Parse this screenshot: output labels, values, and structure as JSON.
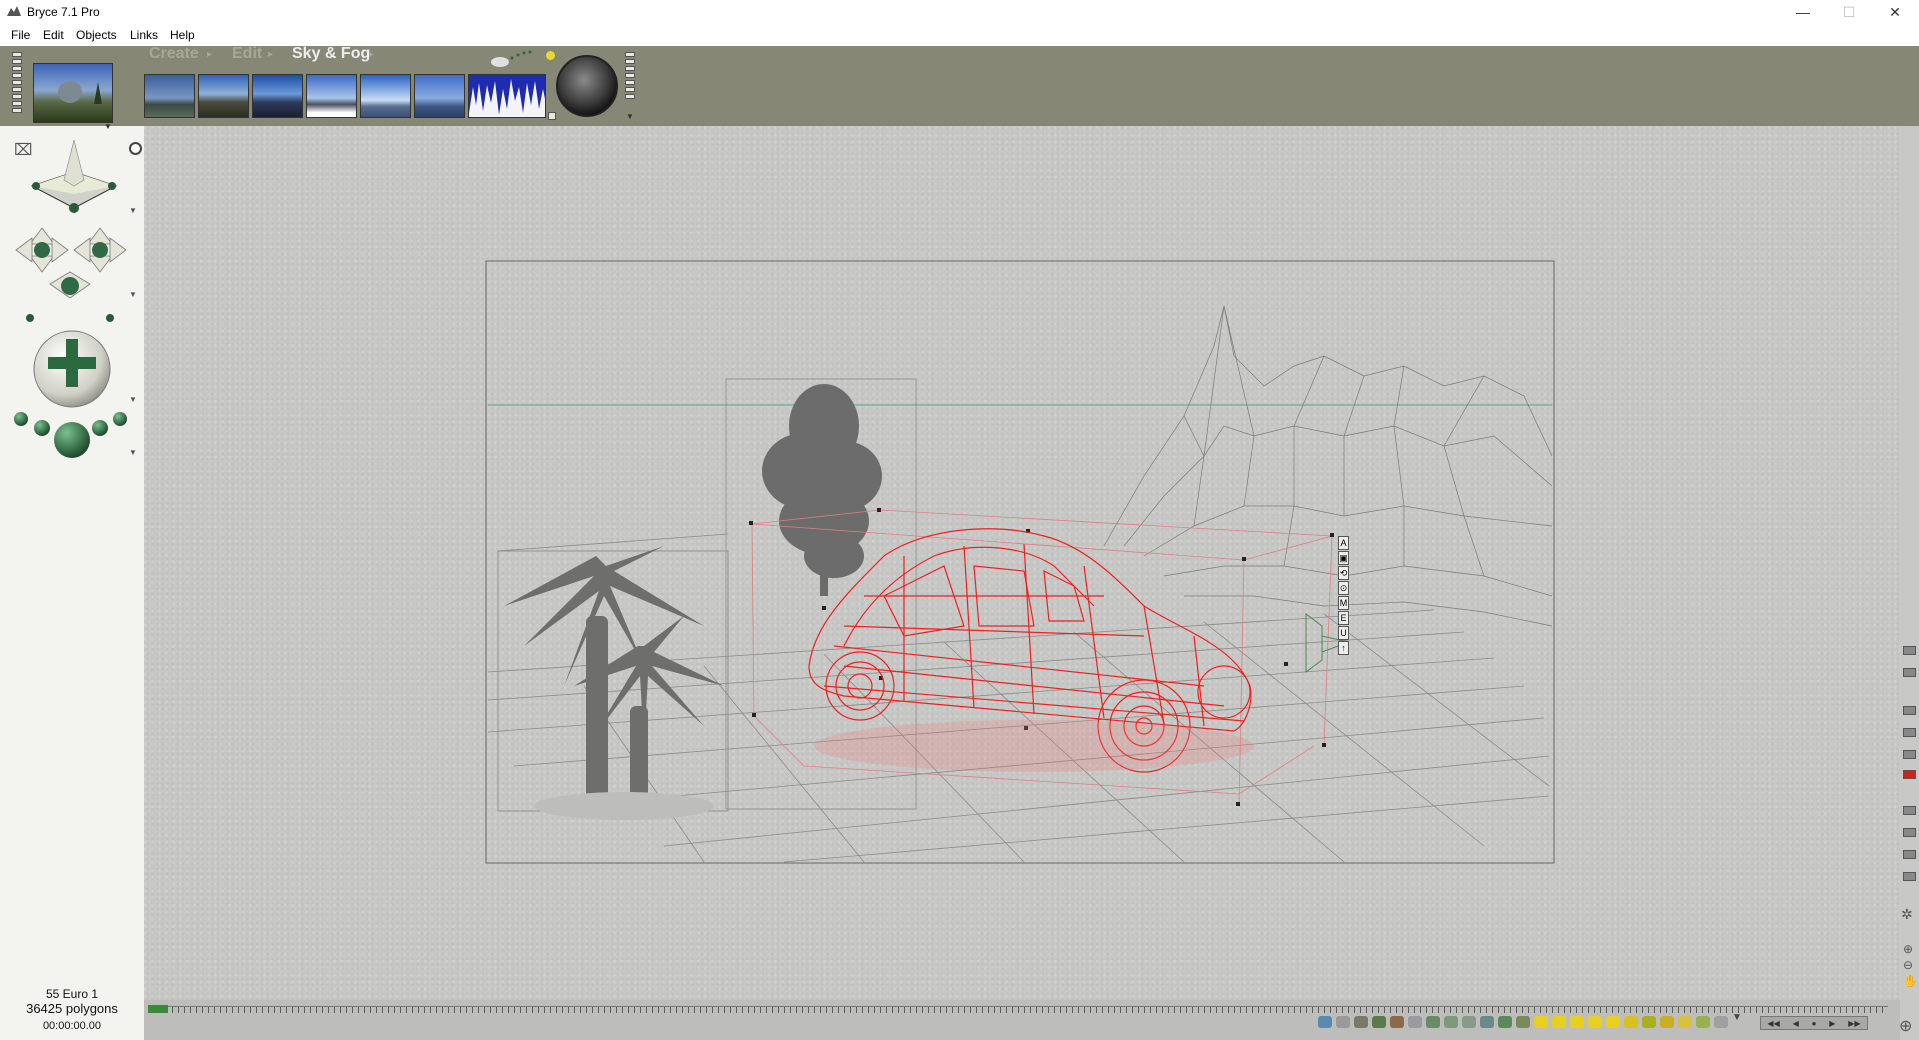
{
  "window": {
    "title": "Bryce 7.1  Pro",
    "controls": {
      "minimize": "—",
      "maximize": "☐",
      "close": "✕"
    }
  },
  "menubar": {
    "items": [
      {
        "label": "File"
      },
      {
        "label": "Edit"
      },
      {
        "label": "Objects"
      },
      {
        "label": "Links"
      },
      {
        "label": "Help"
      }
    ]
  },
  "palette_tabs": {
    "create": "Create",
    "edit": "Edit",
    "sky_fog": "Sky & Fog"
  },
  "status": {
    "scene_name": "55 Euro 1",
    "polygons": "36425 polygons",
    "time": "00:00:00.00"
  },
  "object_attribute_labels": [
    "A",
    "▣",
    "⟲",
    "⊙",
    "M",
    "E",
    "U",
    "↑"
  ],
  "colors": {
    "selection": "#ee2020",
    "toolbar_bg": "#868775",
    "viewport_bg": "#c8c8c6",
    "horizon_line": "#5aa89a"
  }
}
